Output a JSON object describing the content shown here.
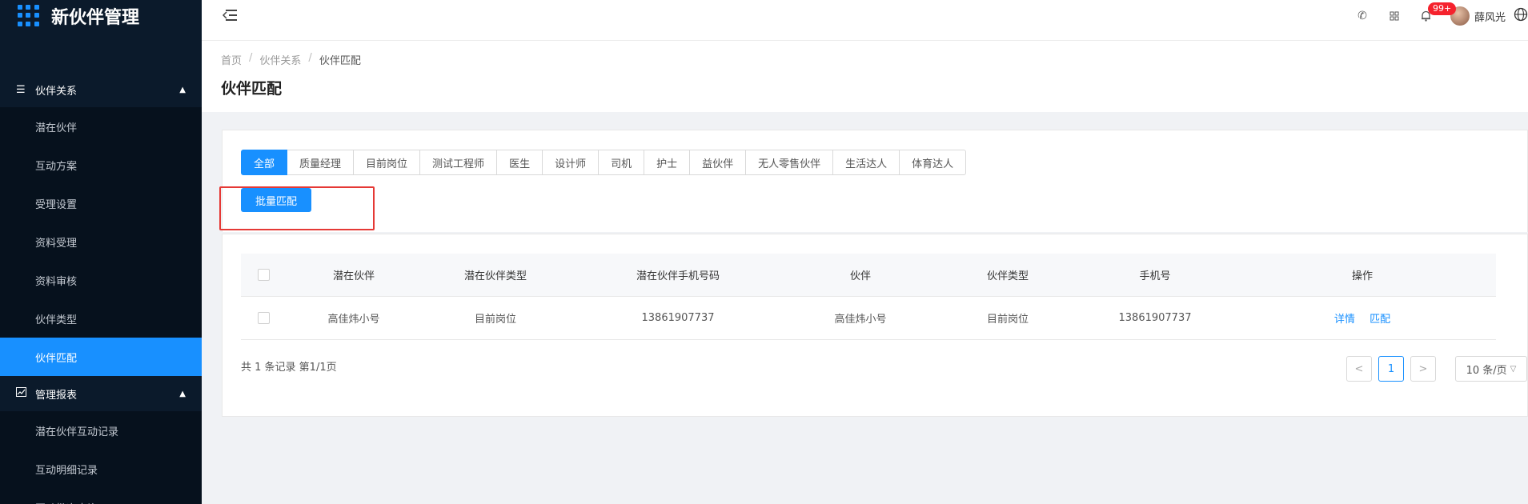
{
  "app": {
    "title": "新伙伴管理"
  },
  "sidebar": {
    "groups": [
      {
        "label": "伙伴关系",
        "icon": "list-icon",
        "items": [
          "潜在伙伴",
          "互动方案",
          "受理设置",
          "资料受理",
          "资料审核",
          "伙伴类型",
          "伙伴匹配"
        ]
      },
      {
        "label": "管理报表",
        "icon": "chart-icon",
        "items": [
          "潜在伙伴互动记录",
          "互动明细记录",
          "互动批次查询"
        ]
      }
    ],
    "active_item": "伙伴匹配"
  },
  "header": {
    "badge": "99+",
    "user_name": "薛风光",
    "icons": [
      "phone-icon",
      "grid-icon",
      "bell-icon",
      "globe-icon"
    ]
  },
  "breadcrumb": [
    "首页",
    "伙伴关系",
    "伙伴匹配"
  ],
  "page_title": "伙伴匹配",
  "tabs": [
    "全部",
    "质量经理",
    "目前岗位",
    "测试工程师",
    "医生",
    "设计师",
    "司机",
    "护士",
    "益伙伴",
    "无人零售伙伴",
    "生活达人",
    "体育达人"
  ],
  "active_tab": "全部",
  "batch_button": "批量匹配",
  "table": {
    "columns": [
      "潜在伙伴",
      "潜在伙伴类型",
      "潜在伙伴手机号码",
      "伙伴",
      "伙伴类型",
      "手机号",
      "操作"
    ],
    "rows": [
      [
        "高佳炜小号",
        "目前岗位",
        "13861907737",
        "高佳炜小号",
        "目前岗位",
        "13861907737"
      ]
    ],
    "actions": [
      "详情",
      "匹配"
    ]
  },
  "pagination": {
    "summary": "共 1 条记录 第1/1页",
    "current_page": "1",
    "prev": "<",
    "next": ">",
    "page_size": "10 条/页"
  },
  "colors": {
    "primary": "#1890ff",
    "sidebar": "#0b1a2b",
    "highlight": "#e53935"
  }
}
